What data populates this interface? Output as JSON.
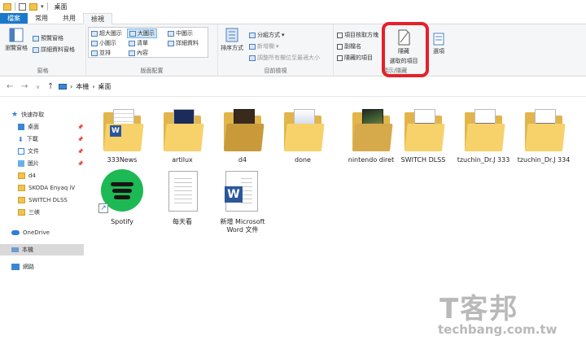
{
  "window": {
    "title": "桌面"
  },
  "tabs": [
    {
      "label": "檔案"
    },
    {
      "label": "常用"
    },
    {
      "label": "共用"
    },
    {
      "label": "檢視"
    }
  ],
  "ribbon": {
    "panes": {
      "nav_pane": "瀏覽窗格",
      "preview_pane": "預覽窗格",
      "details_pane": "詳細資料窗格",
      "group_label": "窗格"
    },
    "layout": {
      "xl_icons": "超大圖示",
      "large_icons": "大圖示",
      "medium_icons": "中圖示",
      "small_icons": "小圖示",
      "list": "清單",
      "details": "詳細資料",
      "tiles": "並排",
      "content": "內容",
      "group_label": "版面配置"
    },
    "current_view": {
      "sort_by": "排序方式",
      "group_by": "分組方式",
      "add_columns": "新增欄",
      "size_columns": "調整所有欄位至最適大小",
      "group_label": "目前檢視"
    },
    "show_hide": {
      "item_checkboxes": "項目核取方塊",
      "file_extensions": "副檔名",
      "hidden_items": "隱藏的項目",
      "hide_selected_line1": "隱藏",
      "hide_selected_line2": "選取的項目",
      "options": "選項",
      "group_label": "顯示/隱藏"
    }
  },
  "address": {
    "crumbs": [
      "本機",
      "桌面"
    ]
  },
  "nav": {
    "quick_access": "快速存取",
    "items": [
      {
        "label": "桌面",
        "pinned": true
      },
      {
        "label": "下載",
        "pinned": true
      },
      {
        "label": "文件",
        "pinned": true
      },
      {
        "label": "圖片",
        "pinned": true
      },
      {
        "label": "d4"
      },
      {
        "label": "SKODA Enyaq iV"
      },
      {
        "label": "SWITCH DLSS"
      },
      {
        "label": "三峽"
      }
    ],
    "onedrive": "OneDrive",
    "this_pc": "本機",
    "network": "網路"
  },
  "files": [
    {
      "name": "333News",
      "kind": "folder"
    },
    {
      "name": "artilux",
      "kind": "folder"
    },
    {
      "name": "d4",
      "kind": "folder"
    },
    {
      "name": "done",
      "kind": "folder"
    },
    {
      "name": "nintendo diret",
      "kind": "folder"
    },
    {
      "name": "SWITCH DLSS",
      "kind": "folder"
    },
    {
      "name": "tzuchin_Dr.J 333",
      "kind": "folder"
    },
    {
      "name": "tzuchin_Dr.J 334",
      "kind": "folder"
    },
    {
      "name": "Spotify",
      "kind": "shortcut"
    },
    {
      "name": "每天看",
      "kind": "text"
    },
    {
      "name_line1": "新增 Microsoft",
      "name_line2": "Word 文件",
      "kind": "word"
    }
  ],
  "watermark": {
    "mark": "T客邦",
    "text": "techbang.com.tw"
  },
  "colors": {
    "accent": "#1979ca",
    "highlight": "#e5202a",
    "folder": "#f7d16a"
  }
}
